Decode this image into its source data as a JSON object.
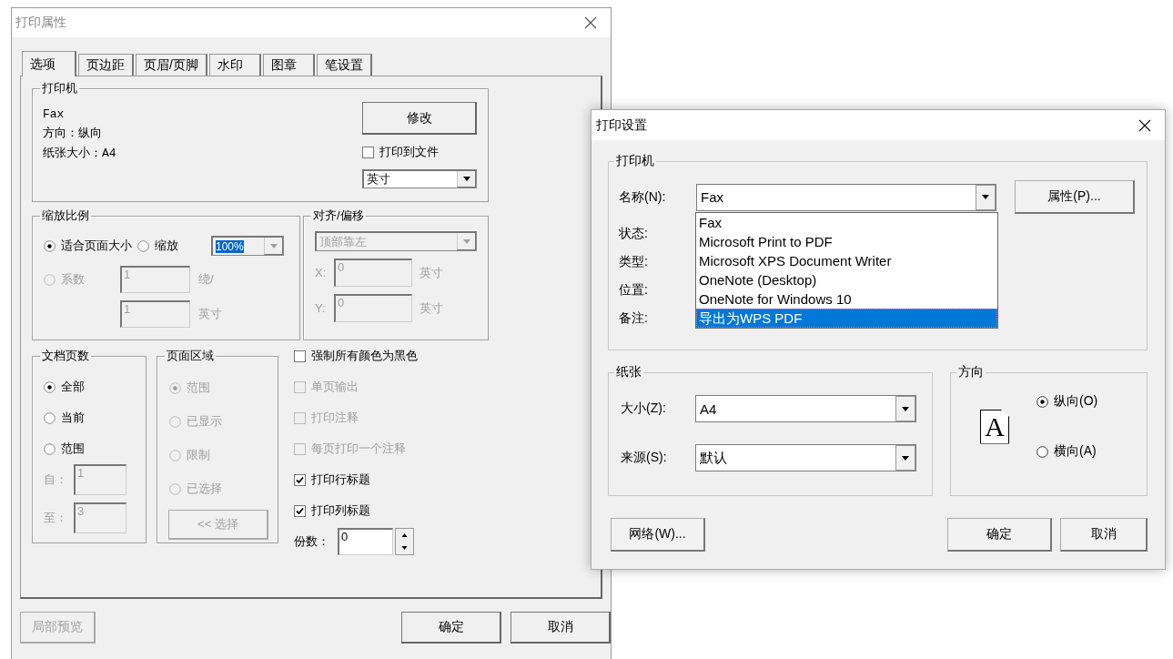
{
  "properties_dialog": {
    "title": "打印属性",
    "tabs": [
      {
        "label": "选项",
        "selected": true
      },
      {
        "label": "页边距",
        "selected": false
      },
      {
        "label": "页眉/页脚",
        "selected": false
      },
      {
        "label": "水印",
        "selected": false
      },
      {
        "label": "图章",
        "selected": false
      },
      {
        "label": "笔设置",
        "selected": false
      }
    ],
    "printer": {
      "title": "打印机",
      "lines": [
        "Fax",
        "方向：纵向",
        "纸张大小：A4"
      ],
      "modify_button": "修改",
      "print_to_file": {
        "label": "打印到文件",
        "checked": false
      },
      "unit": "英寸"
    },
    "scale": {
      "title": "缩放比例",
      "options": [
        {
          "label": "适合页面大小",
          "selected": true,
          "disabled": false
        },
        {
          "label": "缩放",
          "selected": false,
          "disabled": false
        },
        {
          "label": "系数",
          "selected": false,
          "disabled": true
        }
      ],
      "zoom_value": "100%",
      "factor_value": "1",
      "factor_unit": "绕/",
      "size_value": "1",
      "size_unit": "英寸"
    },
    "align": {
      "title": "对齐/偏移",
      "disabled": true,
      "position": "顶部靠左",
      "x_label": "X:",
      "x_value": "0",
      "x_unit": "英寸",
      "y_label": "Y:",
      "y_value": "0",
      "y_unit": "英寸"
    },
    "pages": {
      "title": "文档页数",
      "options": [
        {
          "label": "全部",
          "selected": true
        },
        {
          "label": "当前",
          "selected": false
        },
        {
          "label": "范围",
          "selected": false
        }
      ],
      "from_label": "自：",
      "from_value": "1",
      "to_label": "至：",
      "to_value": "3"
    },
    "area": {
      "title": "页面区域",
      "disabled": true,
      "options": [
        {
          "label": "范围",
          "selected": true
        },
        {
          "label": "已显示",
          "selected": false
        },
        {
          "label": "限制",
          "selected": false
        },
        {
          "label": "已选择",
          "selected": false
        }
      ],
      "select_button": "<< 选择"
    },
    "checks": [
      {
        "label": "强制所有颜色为黑色",
        "checked": false,
        "disabled": false
      },
      {
        "label": "单页输出",
        "checked": false,
        "disabled": true
      },
      {
        "label": "打印注释",
        "checked": false,
        "disabled": true
      },
      {
        "label": "每页打印一个注释",
        "checked": false,
        "disabled": true
      },
      {
        "label": "打印行标题",
        "checked": true,
        "disabled": false
      },
      {
        "label": "打印列标题",
        "checked": true,
        "disabled": false
      }
    ],
    "copies": {
      "label": "份数：",
      "value": "0"
    },
    "buttons": [
      {
        "label": "局部预览",
        "disabled": true
      },
      {
        "label": "确定",
        "disabled": false
      },
      {
        "label": "取消",
        "disabled": false
      }
    ]
  },
  "print_dialog": {
    "title": "打印设置",
    "printer": {
      "title": "打印机",
      "name_label": "名称(N):",
      "name_value": "Fax",
      "properties_button": "属性(P)...",
      "info_labels": [
        "状态:",
        "类型:",
        "位置:",
        "备注:"
      ],
      "dropdown_items": [
        {
          "label": "Fax",
          "selected": false
        },
        {
          "label": "Microsoft Print to PDF",
          "selected": false
        },
        {
          "label": "Microsoft XPS Document Writer",
          "selected": false
        },
        {
          "label": "OneNote (Desktop)",
          "selected": false
        },
        {
          "label": "OneNote for Windows 10",
          "selected": false
        },
        {
          "label": "导出为WPS PDF",
          "selected": true
        }
      ]
    },
    "paper": {
      "title": "纸张",
      "size_label": "大小(Z):",
      "size_value": "A4",
      "source_label": "来源(S):",
      "source_value": "默认"
    },
    "orientation": {
      "title": "方向",
      "page_letter": "A",
      "options": [
        {
          "label": "纵向(O)",
          "selected": true
        },
        {
          "label": "横向(A)",
          "selected": false
        }
      ]
    },
    "buttons": [
      {
        "label": "网络(W)..."
      },
      {
        "label": "确定"
      },
      {
        "label": "取消"
      }
    ]
  }
}
